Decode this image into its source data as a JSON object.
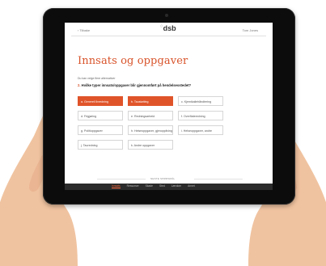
{
  "topbar": {
    "back_label": "‹ Tilbake",
    "logo_text": "dsb",
    "logo_mark": "◌",
    "user_label": "Tom Jones"
  },
  "page": {
    "title": "Innsats og oppgaver",
    "hint": "Du kan velge flere alternativer",
    "question_number": "2.",
    "question_text": "Hvilke typer innsats/oppgaver blir gjennomført på hendelsesstedet?"
  },
  "options": [
    {
      "label": "a. Generell livredning",
      "selected": true
    },
    {
      "label": "b. Taustøtting",
      "selected": true
    },
    {
      "label": "c. Kjemikaliehåndtering",
      "selected": false
    },
    {
      "label": "d. Frigjøring",
      "selected": false
    },
    {
      "label": "e. Redningsarbeid",
      "selected": false
    },
    {
      "label": "f. Overflateredning",
      "selected": false
    },
    {
      "label": "g. Politioppgaver",
      "selected": false
    },
    {
      "label": "h. Helseoppgaver, gjenoppliving",
      "selected": false
    },
    {
      "label": "i. Helseoppgaver, andre",
      "selected": false
    },
    {
      "label": "j. Tauredning",
      "selected": false
    },
    {
      "label": "k. Andre oppgaver",
      "selected": false
    }
  ],
  "footer": {
    "next_label": "NESTE SPØRSMÅL",
    "nav": [
      {
        "label": "Innsats",
        "active": true
      },
      {
        "label": "Ressurser",
        "active": false
      },
      {
        "label": "Skade",
        "active": false
      },
      {
        "label": "Sted",
        "active": false
      },
      {
        "label": "Lærdom",
        "active": false
      },
      {
        "label": "Annet",
        "active": false
      }
    ]
  },
  "colors": {
    "accent": "#e0542a",
    "title": "#d8532a",
    "tablet_frame": "#0c0c0c",
    "skin": "#f2c5a4"
  }
}
